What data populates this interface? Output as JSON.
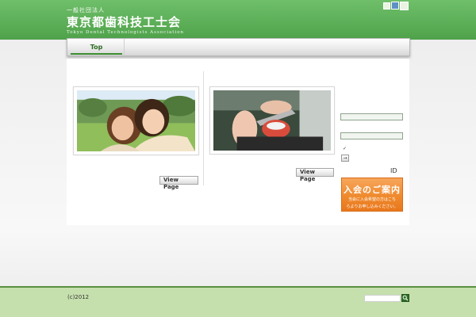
{
  "header": {
    "org_type": "一般社団法人",
    "org_name": "東京都歯科技工士会",
    "org_name_en": "Tokyo Dental Technologists Association",
    "font_size_buttons": [
      "font-size-small",
      "font-size-medium",
      "font-size-large"
    ]
  },
  "nav": {
    "items": [
      {
        "label": "Top"
      }
    ]
  },
  "content": {
    "left_card": {
      "button": "View Page"
    },
    "right_card": {
      "button": "View Page"
    }
  },
  "login": {
    "id_label": "ID",
    "checkbox_mark": "✓",
    "submit_label": "→"
  },
  "banner": {
    "title": "入会のご案内",
    "line1": "当会に入会希望の方はこち",
    "line2": "らよりお申し込みください。"
  },
  "footer": {
    "copyright": "(c)2012"
  },
  "colors": {
    "header_green": "#4fa24a",
    "footer_green": "#c6e0ad",
    "banner_orange": "#ef8a2d",
    "accent_dark_green": "#2f6f25"
  },
  "icons": [
    "search-icon",
    "arrow-right-icon",
    "checkmark-icon"
  ]
}
